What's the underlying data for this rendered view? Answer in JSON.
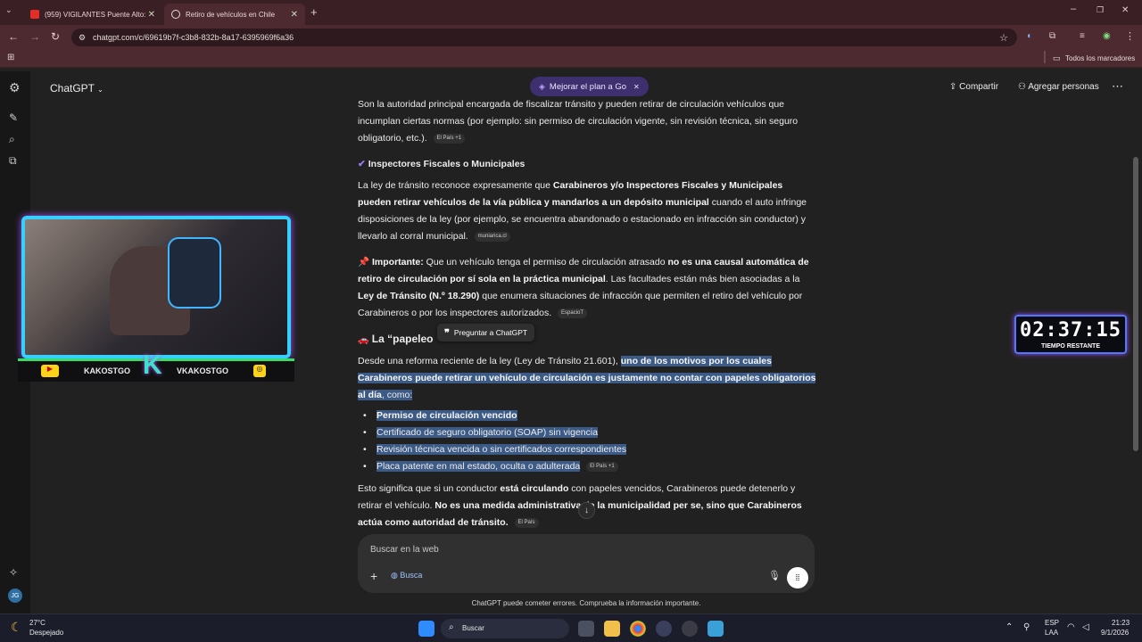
{
  "browser": {
    "tabs": [
      {
        "label": "(959) VIGILANTES Puente Alto:",
        "active": false
      },
      {
        "label": "Retiro de vehículos en Chile",
        "active": true
      }
    ],
    "url": "chatgpt.com/c/69619b7f-c3b8-832b-8a17-6395969f6a36",
    "bookmarks_label": "Todos los marcadores"
  },
  "app": {
    "model": "ChatGPT",
    "upgrade": "Mejorar el plan a Go",
    "share": "Compartir",
    "add_people": "Agregar personas",
    "avatar": "JG"
  },
  "message": {
    "p1": "Son la autoridad principal encargada de fiscalizar tránsito y pueden retirar de circulación vehículos que incumplan ciertas normas (por ejemplo: sin permiso de circulación vigente, sin revisión técnica, sin seguro obligatorio, etc.).",
    "p1_cite": "El País",
    "p1_cite_more": "+1",
    "h_inspectors": "Inspectores Fiscales o Municipales",
    "p2_a": "La ley de tránsito reconoce expresamente que ",
    "p2_b": "Carabineros y/o Inspectores Fiscales y Municipales pueden retirar vehículos de la vía pública y mandarlos a un depósito municipal",
    "p2_c": " cuando el auto infringe disposiciones de la ley (por ejemplo, se encuentra abandonado o estacionado en infracción sin conductor) y llevarlo al corral municipal.",
    "p2_cite": "muniarica.cl",
    "p3_label": "Importante:",
    "p3_a": " Que un vehículo tenga el permiso de circulación atrasado ",
    "p3_b": "no es una causal automática de retiro de circulación por sí sola en la práctica municipal",
    "p3_c": ". Las facultades están más bien asociadas a la ",
    "p3_d": "Ley de Tránsito (N.º 18.290)",
    "p3_e": " que enumera situaciones de infracción que permiten el retiro del vehículo por Carabineros o por los inspectores autorizados.",
    "p3_cite": "EspacioT",
    "h_papeleo": "La “papeleo",
    "tooltip": "Preguntar a ChatGPT",
    "p4_a": "Desde una reforma reciente de la ley (Ley de Tránsito 21.601), ",
    "p4_b": "uno de los motivos por los cuales Carabineros puede retirar un vehículo de circulación es justamente no contar con papeles obligatorios al día",
    "p4_c": ", como:",
    "bullets": [
      "Permiso de circulación vencido",
      "Certificado de seguro obligatorio (SOAP) sin vigencia",
      "Revisión técnica vencida o sin certificados correspondientes",
      "Placa patente en mal estado, oculta o adulterada"
    ],
    "bullet_cite": "El País",
    "bullet_cite_more": "+1",
    "p5_a": "Esto significa que si un conductor ",
    "p5_b": "está circulando",
    "p5_c": " con papeles vencidos, Carabineros puede detenerlo y retirar el vehículo. ",
    "p5_d": "No es una medida administrativa de la municipalidad per se, sino que Carabineros actúa como autoridad de tránsito.",
    "p5_cite": "El País"
  },
  "composer": {
    "placeholder": "Buscar en la web",
    "search_chip": "Busca",
    "disclaimer": "ChatGPT puede cometer errores. Comprueba la información importante."
  },
  "overlay": {
    "cam_left": "KAKOSTGO",
    "cam_right": "VKAKOSTGO",
    "timer": "02:37:15",
    "timer_label": "TIEMPO RESTANTE"
  },
  "taskbar": {
    "weather_temp": "27°C",
    "weather_desc": "Despejado",
    "search": "Buscar",
    "lang": "ESP",
    "lang2": "LAA",
    "time": "21:23",
    "date": "9/1/2026"
  },
  "colors": {
    "selection": "#3b5a86",
    "upgrade_bg": "#3e2f6e",
    "frame_bg": "#3a1f24"
  }
}
